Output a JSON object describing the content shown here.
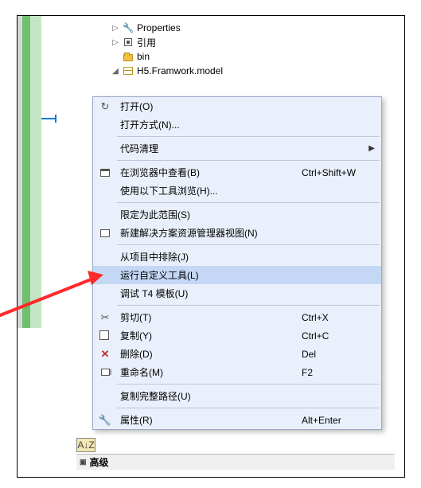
{
  "tree": {
    "items": [
      {
        "exp": "▷",
        "icon": "wrench",
        "label": "Properties"
      },
      {
        "exp": "▷",
        "icon": "ref",
        "label": "引用"
      },
      {
        "exp": "",
        "icon": "folder",
        "label": "bin"
      },
      {
        "exp": "◢",
        "icon": "model",
        "label": "H5.Framwork.model"
      }
    ]
  },
  "menu": {
    "groups": [
      [
        {
          "icon": "open",
          "label": "打开(O)",
          "shortcut": ""
        },
        {
          "icon": "",
          "label": "打开方式(N)...",
          "shortcut": ""
        }
      ],
      [
        {
          "icon": "",
          "label": "代码清理",
          "shortcut": "",
          "submenu": true
        }
      ],
      [
        {
          "icon": "browser",
          "label": "在浏览器中查看(B)",
          "shortcut": "Ctrl+Shift+W"
        },
        {
          "icon": "",
          "label": "使用以下工具浏览(H)...",
          "shortcut": ""
        }
      ],
      [
        {
          "icon": "",
          "label": "限定为此范围(S)",
          "shortcut": ""
        },
        {
          "icon": "newview",
          "label": "新建解决方案资源管理器视图(N)",
          "shortcut": ""
        }
      ],
      [
        {
          "icon": "",
          "label": "从项目中排除(J)",
          "shortcut": ""
        },
        {
          "icon": "",
          "label": "运行自定义工具(L)",
          "shortcut": "",
          "hover": true
        },
        {
          "icon": "",
          "label": "调试 T4 模板(U)",
          "shortcut": ""
        }
      ],
      [
        {
          "icon": "cut",
          "label": "剪切(T)",
          "shortcut": "Ctrl+X"
        },
        {
          "icon": "copy",
          "label": "复制(Y)",
          "shortcut": "Ctrl+C"
        },
        {
          "icon": "del",
          "label": "删除(D)",
          "shortcut": "Del"
        },
        {
          "icon": "rename",
          "label": "重命名(M)",
          "shortcut": "F2"
        }
      ],
      [
        {
          "icon": "",
          "label": "复制完整路径(U)",
          "shortcut": ""
        }
      ],
      [
        {
          "icon": "prop",
          "label": "属性(R)",
          "shortcut": "Alt+Enter"
        }
      ]
    ]
  },
  "below": {
    "sort_label": "A↓Z",
    "section_label": "高级"
  }
}
